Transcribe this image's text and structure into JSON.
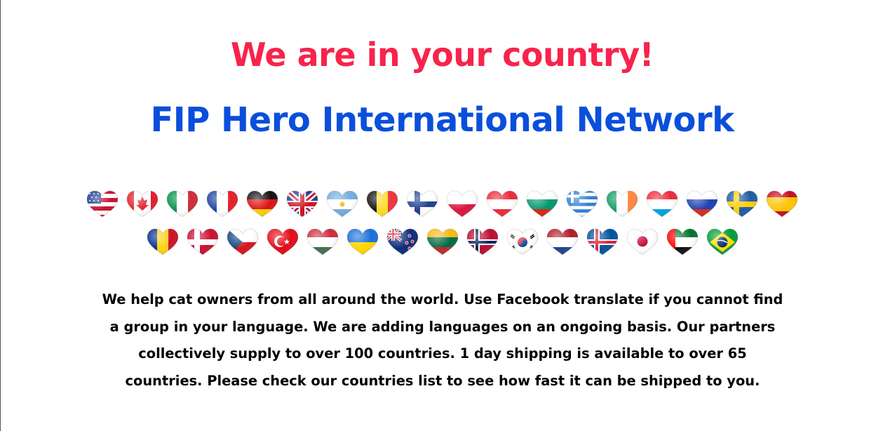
{
  "heading": {
    "line1": "We are in your country!",
    "line2": "FIP Hero International Network",
    "line1_color": "#f8234b",
    "line2_color": "#0a4fdb"
  },
  "flags_row1": [
    {
      "name": "usa-flag-icon"
    },
    {
      "name": "canada-flag-icon"
    },
    {
      "name": "italy-flag-icon"
    },
    {
      "name": "france-flag-icon"
    },
    {
      "name": "germany-flag-icon"
    },
    {
      "name": "uk-flag-icon"
    },
    {
      "name": "argentina-flag-icon"
    },
    {
      "name": "belgium-flag-icon"
    },
    {
      "name": "finland-flag-icon"
    },
    {
      "name": "poland-flag-icon"
    },
    {
      "name": "austria-flag-icon"
    },
    {
      "name": "bulgaria-flag-icon"
    },
    {
      "name": "greece-flag-icon"
    },
    {
      "name": "ireland-flag-icon"
    },
    {
      "name": "luxembourg-flag-icon"
    },
    {
      "name": "russia-flag-icon"
    },
    {
      "name": "sweden-flag-icon"
    },
    {
      "name": "spain-flag-icon"
    }
  ],
  "flags_row2": [
    {
      "name": "romania-flag-icon"
    },
    {
      "name": "denmark-flag-icon"
    },
    {
      "name": "czechia-flag-icon"
    },
    {
      "name": "turkey-flag-icon"
    },
    {
      "name": "hungary-flag-icon"
    },
    {
      "name": "ukraine-flag-icon"
    },
    {
      "name": "new-zealand-flag-icon"
    },
    {
      "name": "lithuania-flag-icon"
    },
    {
      "name": "norway-flag-icon"
    },
    {
      "name": "south-korea-flag-icon"
    },
    {
      "name": "netherlands-flag-icon"
    },
    {
      "name": "iceland-flag-icon"
    },
    {
      "name": "japan-flag-icon"
    },
    {
      "name": "uae-flag-icon"
    },
    {
      "name": "brazil-flag-icon"
    }
  ],
  "description": "We help cat owners from all around the world. Use Facebook translate if you cannot find a group in your language. We are adding languages on an ongoing basis. Our partners collectively supply to over 100 countries. 1 day shipping is available to over 65 countries. Please check our countries list to see how fast it can be shipped to you."
}
